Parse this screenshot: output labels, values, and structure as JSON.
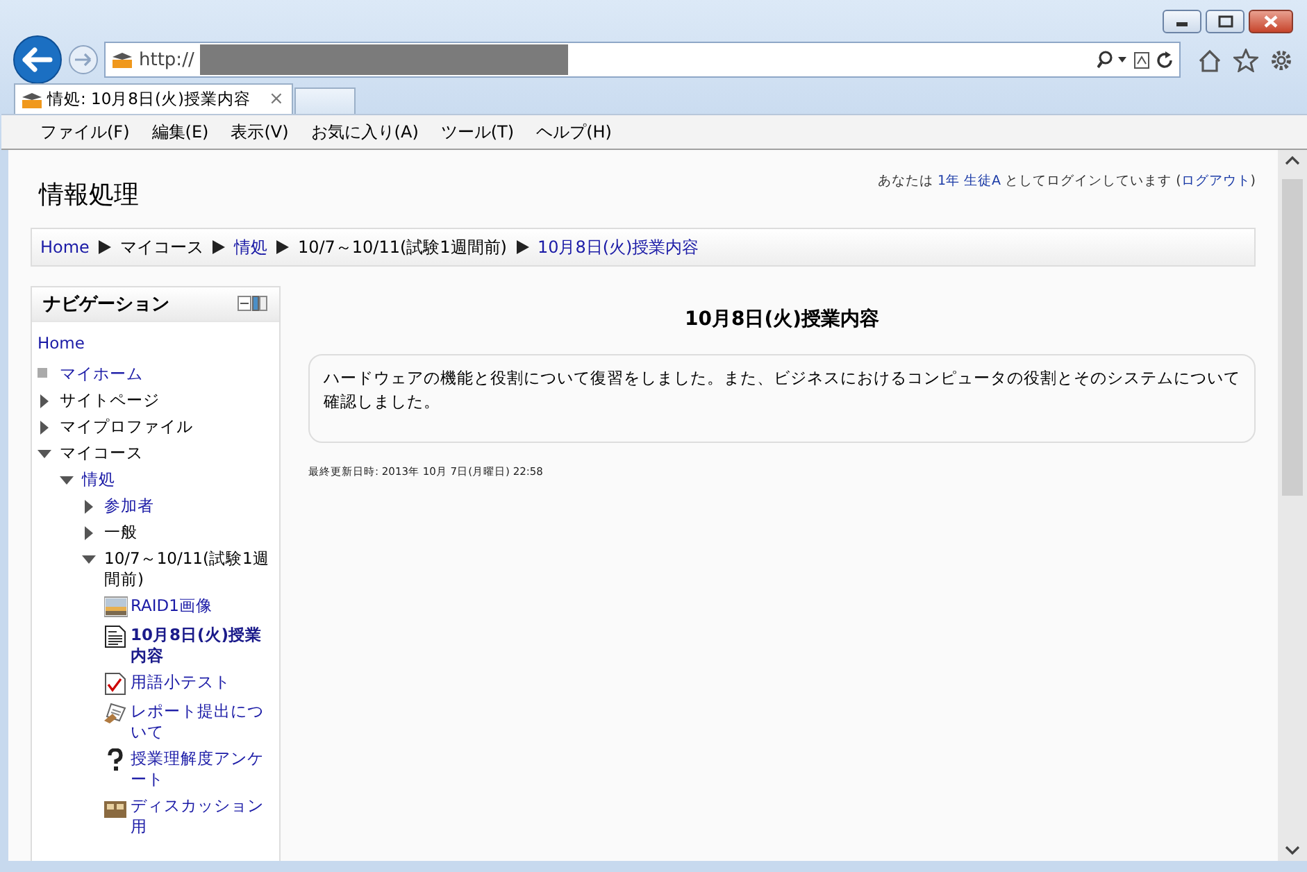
{
  "browser": {
    "address": "http://",
    "tab_title": "情処: 10月8日(火)授業内容",
    "tab_close": "×",
    "menu": [
      "ファイル(F)",
      "編集(E)",
      "表示(V)",
      "お気に入り(A)",
      "ツール(T)",
      "ヘルプ(H)"
    ]
  },
  "header": {
    "site_title": "情報処理",
    "login": [
      {
        "text": "あなたは ",
        "link": false
      },
      {
        "text": "1年 生徒A",
        "link": true
      },
      {
        "text": " としてログインしています (",
        "link": false
      },
      {
        "text": "ログアウト",
        "link": true
      },
      {
        "text": ")",
        "link": false
      }
    ]
  },
  "breadcrumb": [
    {
      "label": "Home",
      "link": true
    },
    {
      "label": "マイコース",
      "link": false
    },
    {
      "label": "情処",
      "link": true
    },
    {
      "label": "10/7～10/11(試験1週間前)",
      "link": false
    },
    {
      "label": "10月8日(火)授業内容",
      "link": true
    }
  ],
  "navigation": {
    "title": "ナビゲーション",
    "items": [
      {
        "label": "Home",
        "kind": "root",
        "link": true
      },
      {
        "label": "マイホーム",
        "kind": "leaf",
        "link": true
      },
      {
        "label": "サイトページ",
        "kind": "branch",
        "link": false,
        "expanded": false
      },
      {
        "label": "マイプロファイル",
        "kind": "branch",
        "link": false,
        "expanded": false
      },
      {
        "label": "マイコース",
        "kind": "branch",
        "link": false,
        "expanded": true,
        "children": [
          {
            "label": "情処",
            "kind": "branch",
            "link": true,
            "expanded": true,
            "children": [
              {
                "label": "参加者",
                "kind": "branch",
                "link": true,
                "expanded": false
              },
              {
                "label": "一般",
                "kind": "branch",
                "link": false,
                "expanded": false
              },
              {
                "label": "10/7～10/11(試験1週間前)",
                "kind": "branch",
                "link": false,
                "expanded": true,
                "children": [
                  {
                    "label": "RAID1画像",
                    "kind": "image",
                    "link": true,
                    "selected": false
                  },
                  {
                    "label": "10月8日(火)授業内容",
                    "kind": "page",
                    "link": true,
                    "selected": true
                  },
                  {
                    "label": "用語小テスト",
                    "kind": "quiz",
                    "link": true,
                    "selected": false
                  },
                  {
                    "label": "レポート提出について",
                    "kind": "assignment",
                    "link": true,
                    "selected": false
                  },
                  {
                    "label": "授業理解度アンケート",
                    "kind": "feedback",
                    "link": true,
                    "selected": false
                  },
                  {
                    "label": "ディスカッション用",
                    "kind": "forum",
                    "link": true,
                    "selected": false
                  }
                ]
              }
            ]
          }
        ]
      }
    ]
  },
  "main": {
    "heading": "10月8日(火)授業内容",
    "summary": "ハードウェアの機能と役割について復習をしました。また、ビジネスにおけるコンピュータの役割とそのシステムについて確認しました。",
    "modified": "最終更新日時: 2013年 10月 7日(月曜日) 22:58"
  }
}
